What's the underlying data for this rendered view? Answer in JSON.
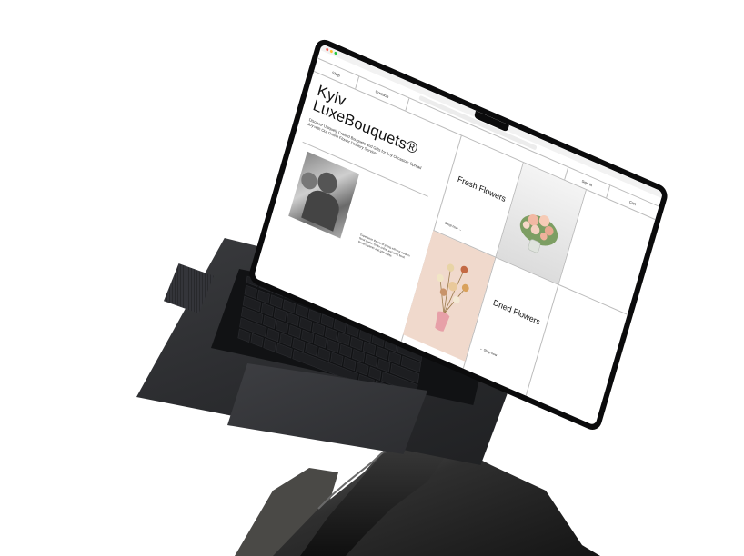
{
  "site": {
    "nav_shop": "Shop",
    "nav_contacts": "Contacts",
    "nav_signin": "Sign In",
    "nav_cart": "Cart",
    "hero_title_line1": "Kyiv",
    "hero_title_line2": "LuxeBouquets®",
    "hero_subtitle": "Discover Uniquely Crafted Bouquets and Gifts for Any Occasion: Spread Joy with Our Online Flower Delivery Service",
    "blurb": "Experience the joy of giving with our modern floral studio. Order online and send fresh flowers, plants and gifts today.",
    "tile_fresh_title": "Fresh Flowers",
    "tile_fresh_link": "Shop now →",
    "tile_dried_title": "Dried Flowers",
    "tile_dried_link": "← Shop now"
  },
  "colors": {
    "laptop_body": "#2b2c2f",
    "bezel": "#0b0b0c",
    "screen_bg": "#ffffff",
    "grid_line": "#bbbbbb",
    "pink_tile": "#f0d9cc",
    "rock": "#2a2a2a"
  },
  "icons": [
    "traffic-light-icon",
    "arrow-right-icon",
    "arrow-left-icon"
  ]
}
